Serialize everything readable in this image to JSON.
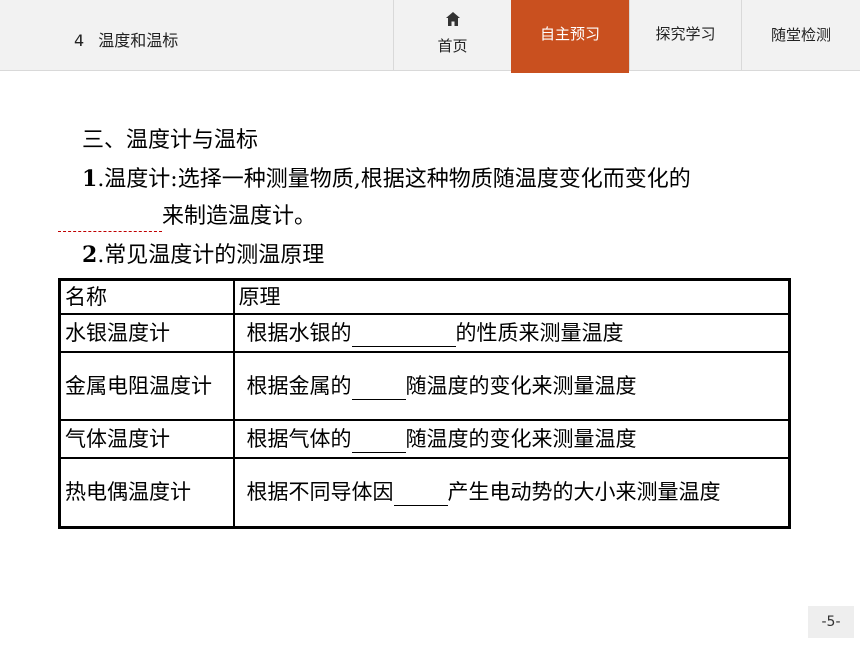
{
  "header": {
    "chapter_number": "4",
    "chapter_title": "温度和温标",
    "nav": {
      "home": "首页",
      "preview": "自主预习",
      "explore": "探究学习",
      "test": "随堂检测"
    }
  },
  "section": {
    "title": "三、温度计与温标",
    "item1": {
      "number": "1",
      "text": ".温度计:选择一种测量物质,根据这种物质随温度变化而变化的",
      "line2_text": "来制造温度计。"
    },
    "item2": {
      "number": "2",
      "text": ".常见温度计的测温原理"
    }
  },
  "table": {
    "headers": [
      "名称",
      "原理"
    ],
    "rows": [
      {
        "name": "水银温度计",
        "pre": "根据水银的",
        "post": "的性质来测量温度"
      },
      {
        "name": "金属电阻温度计",
        "pre": "根据金属的",
        "post": "随温度的变化来测量温度"
      },
      {
        "name": "气体温度计",
        "pre": "根据气体的",
        "post": "随温度的变化来测量温度"
      },
      {
        "name": "热电偶温度计",
        "pre": "根据不同导体因",
        "post": "产生电动势的大小来测量温度"
      }
    ]
  },
  "page_number": "-5-",
  "colors": {
    "accent": "#c9501f",
    "topbar_bg": "#f2f2f2"
  }
}
